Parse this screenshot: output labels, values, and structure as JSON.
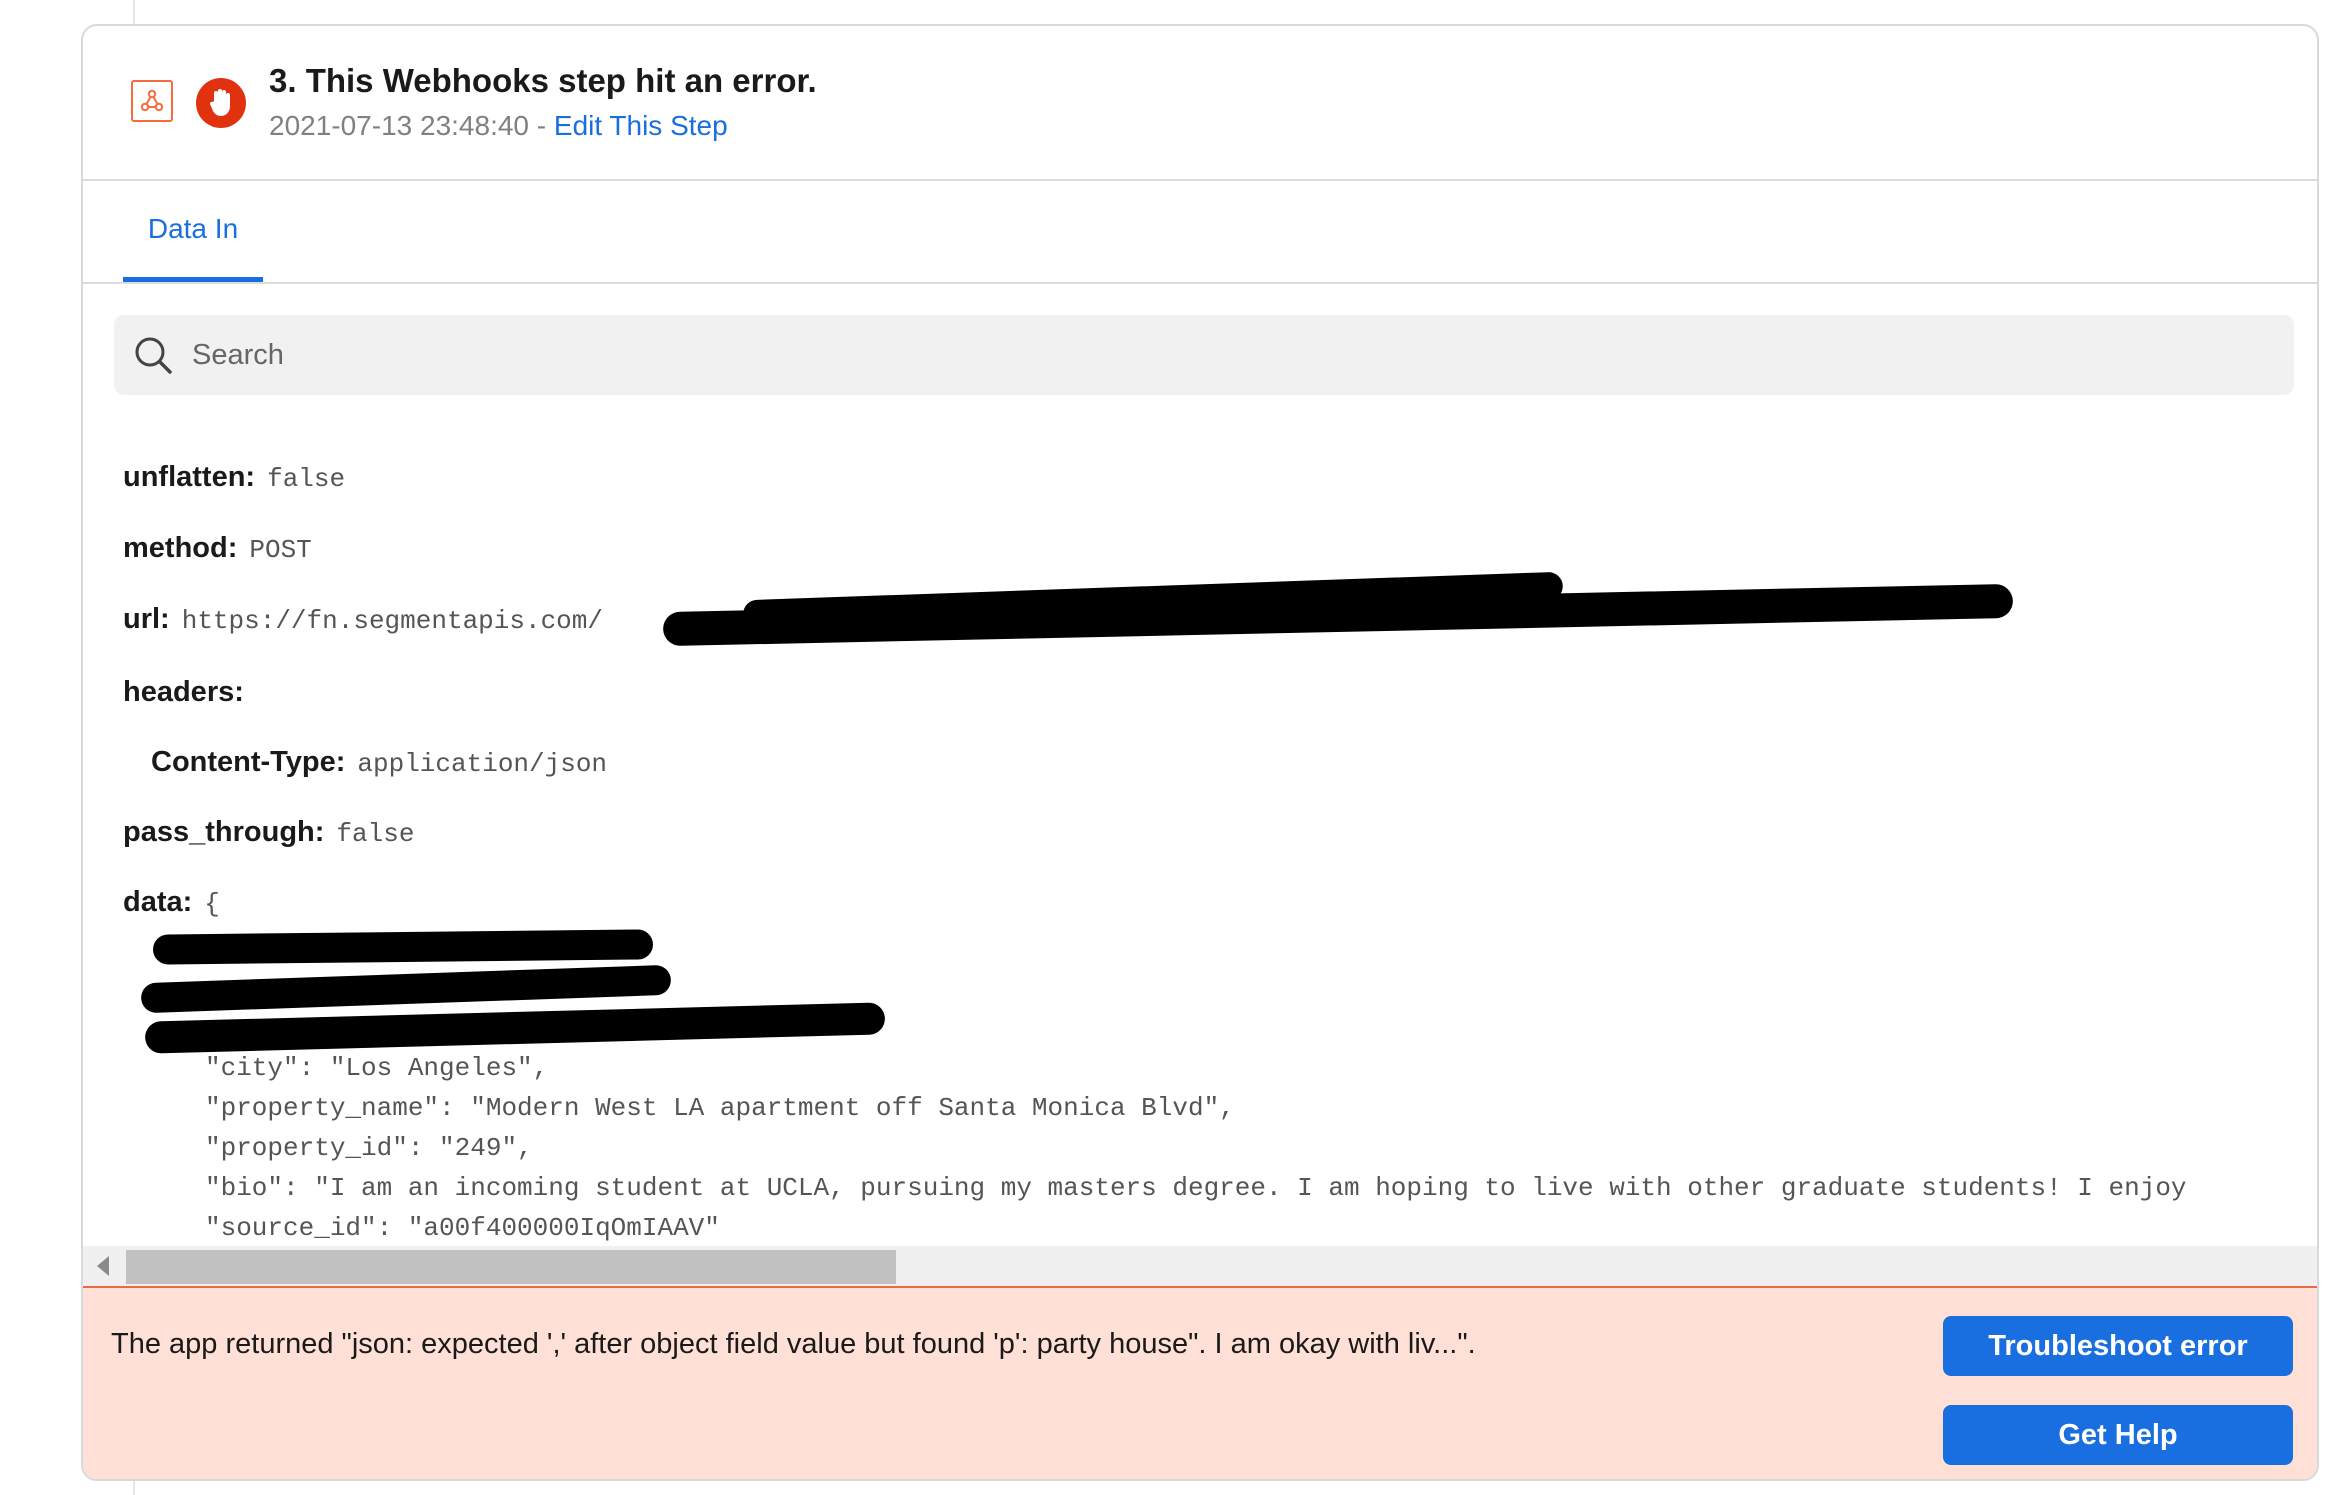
{
  "step": {
    "title": "3. This Webhooks step hit an error.",
    "timestamp": "2021-07-13 23:48:40",
    "separator": " - ",
    "edit_label": "Edit This Step",
    "app_icon": "webhook-icon",
    "status_icon": "stop-hand-icon"
  },
  "tabs": [
    {
      "label": "Data In",
      "active": true
    }
  ],
  "search": {
    "placeholder": "Search"
  },
  "fields": {
    "unflatten": {
      "key": "unflatten:",
      "value": "false"
    },
    "method": {
      "key": "method:",
      "value": "POST"
    },
    "url": {
      "key": "url:",
      "value": "https://fn.segmentapis.com/"
    },
    "headers": {
      "key": "headers:"
    },
    "content_type": {
      "key": "Content-Type:",
      "value": "application/json"
    },
    "pass_through": {
      "key": "pass_through:",
      "value": "false"
    },
    "data": {
      "key": "data:",
      "value": "{"
    }
  },
  "data_lines": [
    "\"city\": \"Los Angeles\",",
    "\"property_name\": \"Modern West LA apartment off Santa Monica Blvd\",",
    "\"property_id\": \"249\",",
    "\"bio\": \"I am an incoming student at UCLA, pursuing my masters degree. I am hoping to live with other graduate students! I enjoy",
    "\"source_id\": \"a00f400000IqOmIAAV\""
  ],
  "error": {
    "message": "The app returned \"json: expected ',' after object field value but found 'p': party house\". I am okay with liv...\".",
    "troubleshoot_label": "Troubleshoot error",
    "help_label": "Get Help"
  },
  "colors": {
    "accent": "#1a6fe0",
    "error_bg": "#ffe0d6",
    "error_border": "#e66b47",
    "stop": "#e0320f",
    "webhook": "#f36b3f"
  }
}
